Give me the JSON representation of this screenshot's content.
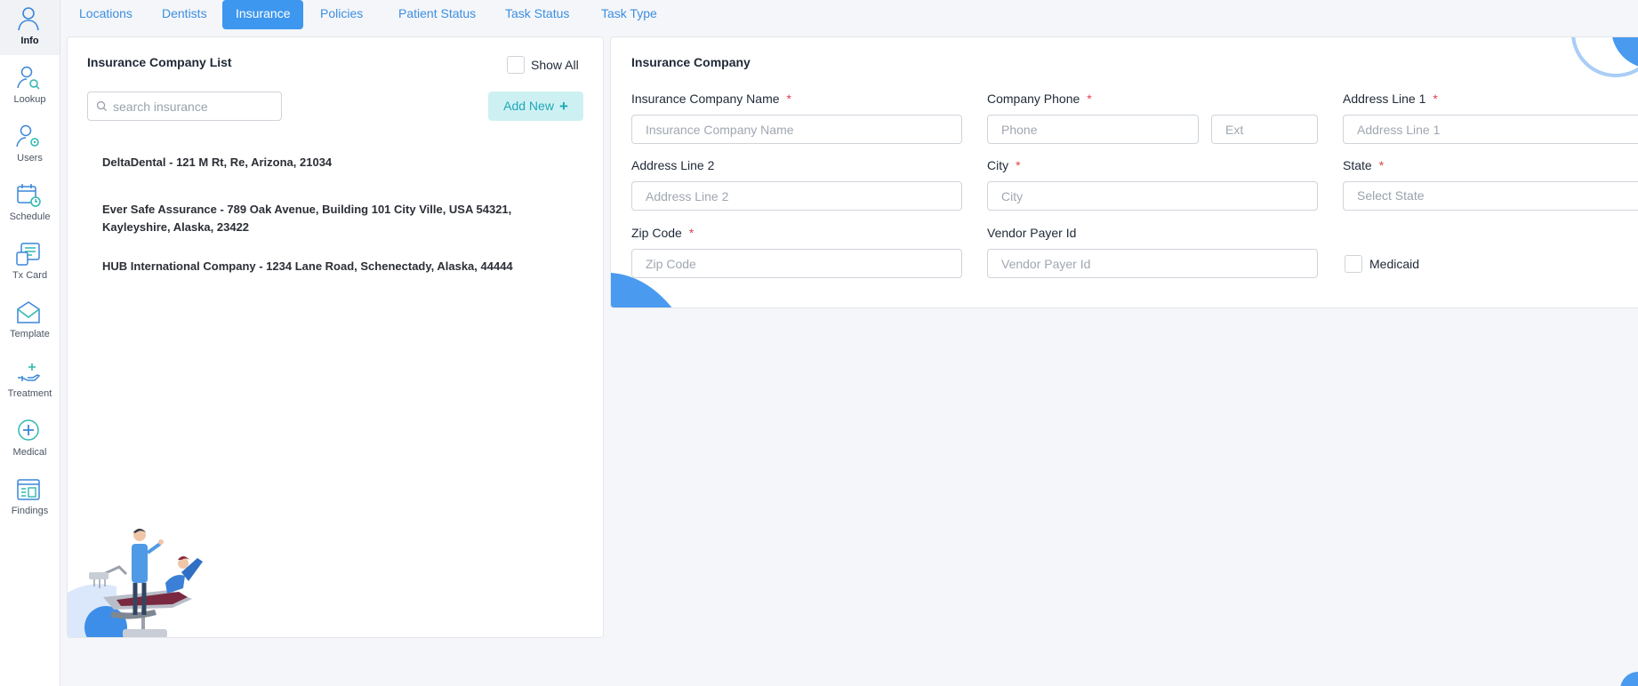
{
  "sidebar": {
    "items": [
      {
        "label": "Info",
        "icon": "user-icon"
      },
      {
        "label": "Lookup",
        "icon": "lookup-icon"
      },
      {
        "label": "Users",
        "icon": "users-icon"
      },
      {
        "label": "Schedule",
        "icon": "calendar-icon"
      },
      {
        "label": "Tx Card",
        "icon": "tx-card-icon"
      },
      {
        "label": "Template",
        "icon": "envelope-icon"
      },
      {
        "label": "Treatment",
        "icon": "treatment-hand-icon"
      },
      {
        "label": "Medical",
        "icon": "medical-cross-icon"
      },
      {
        "label": "Findings",
        "icon": "findings-icon"
      }
    ]
  },
  "tabs": [
    "Locations",
    "Dentists",
    "Insurance",
    "Policies",
    "Patient Status",
    "Task Status",
    "Task Type"
  ],
  "active_tab": "Insurance",
  "list_panel": {
    "title": "Insurance Company List",
    "show_all_label": "Show All",
    "search_placeholder": "search insurance",
    "add_new_label": "Add New",
    "companies": [
      "DeltaDental - 121 M Rt, Re, Arizona, 21034",
      "Ever Safe Assurance - 789 Oak Avenue, Building 101 City Ville, USA 54321, Kayleyshire, Alaska, 23422",
      "HUB International Company - 1234 Lane Road, Schenectady, Alaska, 44444"
    ]
  },
  "form": {
    "title": "Insurance Company",
    "required_marker": "*",
    "company_name": {
      "label": "Insurance Company Name",
      "placeholder": "Insurance Company Name"
    },
    "company_phone": {
      "label": "Company Phone",
      "placeholder": "Phone"
    },
    "ext": {
      "placeholder": "Ext"
    },
    "address1": {
      "label": "Address Line 1",
      "placeholder": "Address Line 1"
    },
    "address2": {
      "label": "Address Line 2",
      "placeholder": "Address Line 2"
    },
    "city": {
      "label": "City",
      "placeholder": "City"
    },
    "state": {
      "label": "State",
      "placeholder": "Select State"
    },
    "zip": {
      "label": "Zip Code",
      "placeholder": "Zip Code"
    },
    "vendor": {
      "label": "Vendor Payer Id",
      "placeholder": "Vendor Payer Id"
    },
    "medicaid_label": "Medicaid"
  },
  "colors": {
    "accent": "#3d97ef",
    "tab_text": "#3d8ee0",
    "add_button_bg": "#cdf1f3",
    "add_button_text": "#1fa7b6",
    "required": "#e0434b",
    "icon_teal": "#2cb9b0",
    "icon_blue": "#3a86d8"
  }
}
